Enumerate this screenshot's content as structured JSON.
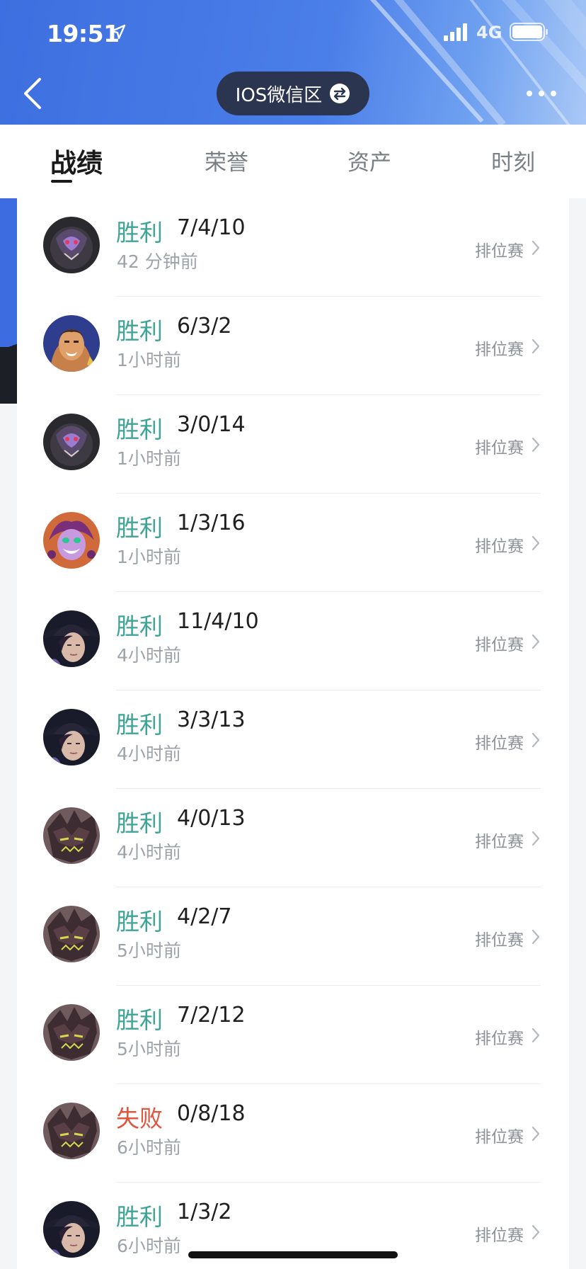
{
  "status_bar": {
    "time": "19:51",
    "network": "4G"
  },
  "header": {
    "region_label": "IOS微信区"
  },
  "tabs": [
    {
      "label": "战绩",
      "active": true
    },
    {
      "label": "荣誉",
      "active": false
    },
    {
      "label": "资产",
      "active": false
    },
    {
      "label": "时刻",
      "active": false
    }
  ],
  "colors": {
    "win": "#3ea596",
    "lose": "#e2553f",
    "header_blue": "#3e6fe0"
  },
  "matches": [
    {
      "result": "胜利",
      "kda": "7/4/10",
      "time": "42 分钟前",
      "mode": "排位赛",
      "avatar": "purple-beast"
    },
    {
      "result": "胜利",
      "kda": "6/3/2",
      "time": "1小时前",
      "mode": "排位赛",
      "avatar": "warrior"
    },
    {
      "result": "胜利",
      "kda": "3/0/14",
      "time": "1小时前",
      "mode": "排位赛",
      "avatar": "purple-beast"
    },
    {
      "result": "胜利",
      "kda": "1/3/16",
      "time": "1小时前",
      "mode": "排位赛",
      "avatar": "jester"
    },
    {
      "result": "胜利",
      "kda": "11/4/10",
      "time": "4小时前",
      "mode": "排位赛",
      "avatar": "hat-lady"
    },
    {
      "result": "胜利",
      "kda": "3/3/13",
      "time": "4小时前",
      "mode": "排位赛",
      "avatar": "hat-lady"
    },
    {
      "result": "胜利",
      "kda": "4/0/13",
      "time": "4小时前",
      "mode": "排位赛",
      "avatar": "rock-golem"
    },
    {
      "result": "胜利",
      "kda": "4/2/7",
      "time": "5小时前",
      "mode": "排位赛",
      "avatar": "rock-golem"
    },
    {
      "result": "胜利",
      "kda": "7/2/12",
      "time": "5小时前",
      "mode": "排位赛",
      "avatar": "rock-golem"
    },
    {
      "result": "失败",
      "kda": "0/8/18",
      "time": "6小时前",
      "mode": "排位赛",
      "avatar": "rock-golem"
    },
    {
      "result": "胜利",
      "kda": "1/3/2",
      "time": "6小时前",
      "mode": "排位赛",
      "avatar": "hat-lady"
    }
  ]
}
